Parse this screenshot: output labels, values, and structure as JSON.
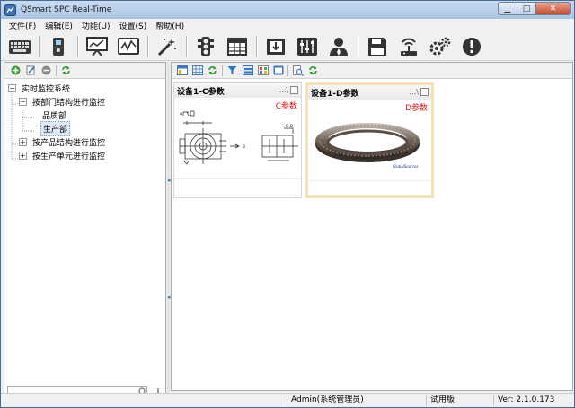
{
  "window": {
    "title": "QSmart SPC Real-Time"
  },
  "menu": [
    "文件(F)",
    "编辑(E)",
    "功能(U)",
    "设置(S)",
    "帮助(H)"
  ],
  "toolbar_icons": [
    "keyboard-icon",
    "device-icon",
    "presentation-icon",
    "monitor-chart-icon",
    "magic-wand-icon",
    "traffic-light-icon",
    "table-icon",
    "import-icon",
    "sliders-icon",
    "user-icon",
    "save-icon",
    "wireless-icon",
    "gears-icon",
    "alert-icon"
  ],
  "tree": {
    "root": "实时监控系统",
    "nodes": [
      {
        "label": "按部门结构进行监控",
        "children": [
          "品质部",
          "生产部"
        ]
      },
      {
        "label": "按产品结构进行监控"
      },
      {
        "label": "按生产单元进行监控"
      }
    ]
  },
  "search": {
    "value": ""
  },
  "cards": [
    {
      "title": "设备1-C参数",
      "param": "C参数",
      "tools": "...\\"
    },
    {
      "title": "设备1-D参数",
      "param": "D参数",
      "tools": "...\\"
    }
  ],
  "status": {
    "user": "Admin(系统管理员)",
    "edition": "试用版",
    "version": "Ver: 2.1.0.173"
  },
  "colors": {
    "accent": "#3e6ea7",
    "param_red": "#dd1111",
    "selected_card_border": "#f2e2b6"
  }
}
